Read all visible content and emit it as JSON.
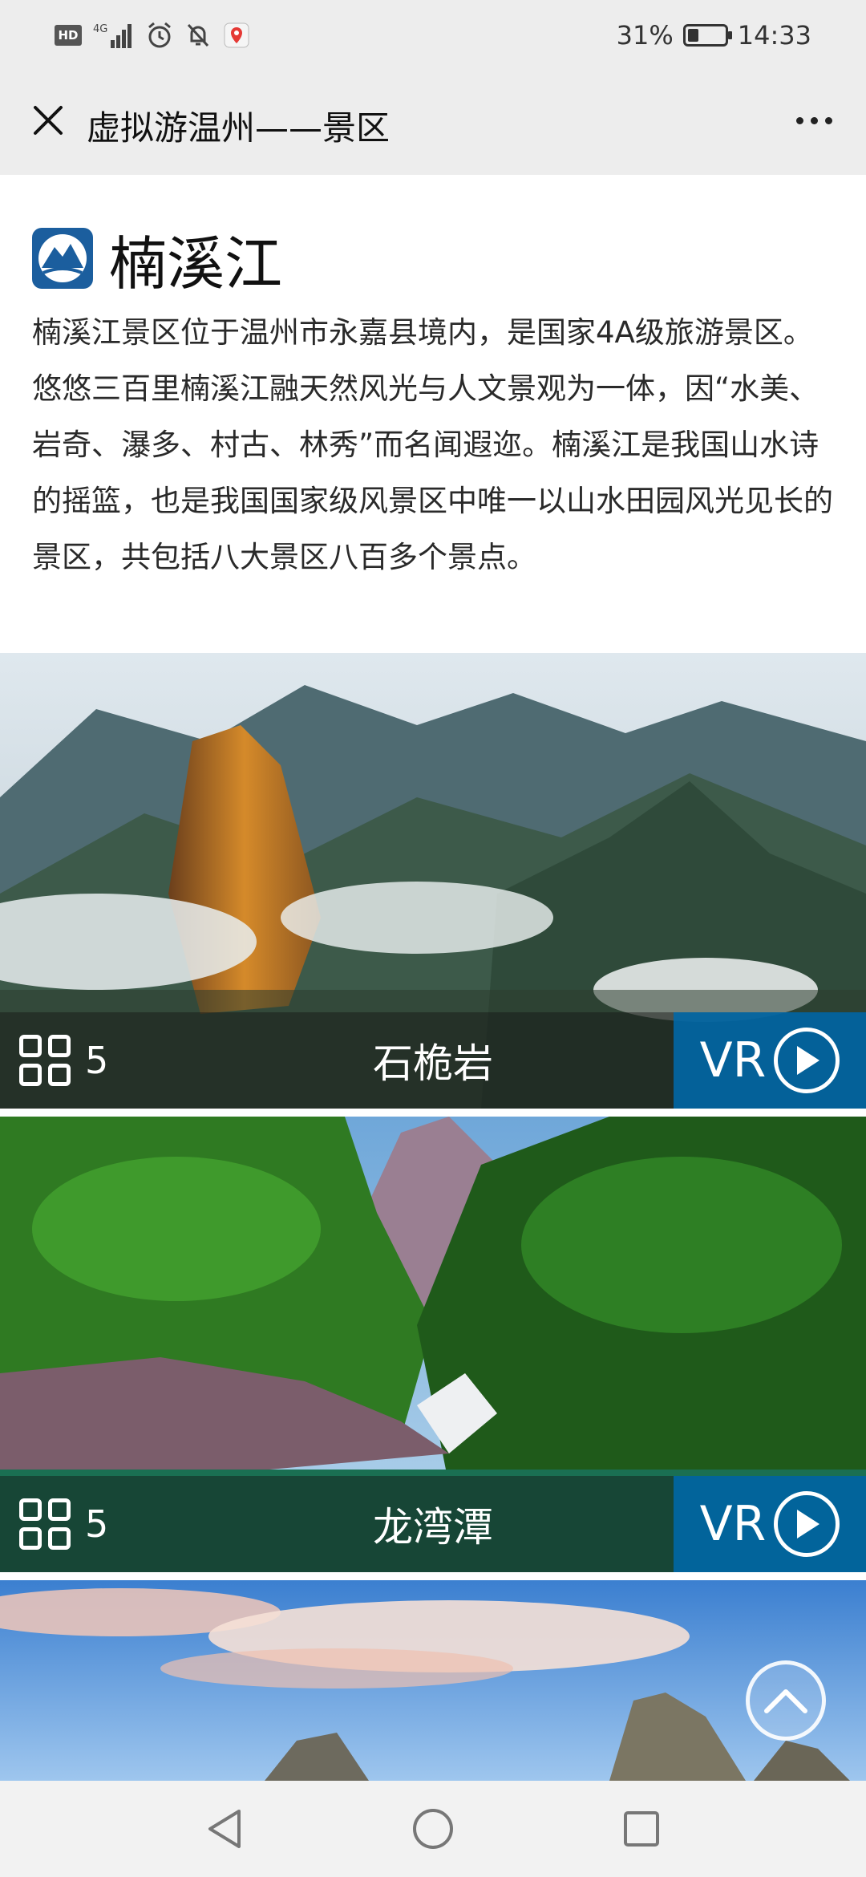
{
  "status_bar": {
    "hd_label": "HD",
    "network_label": "4G",
    "battery_percent": "31%",
    "battery_level": 0.31,
    "time": "14:33"
  },
  "nav": {
    "title": "虚拟游温州——景区"
  },
  "section": {
    "title": "楠溪江",
    "description": "楠溪江景区位于温州市永嘉县境内，是国家4A级旅游景区。悠悠三百里楠溪江融天然风光与人文景观为一体，因“水美、岩奇、瀑多、村古、林秀”而名闻遐迩。楠溪江是我国山水诗的摇篮，也是我国国家级风景区中唯一以山水田园风光见长的景区，共包括八大景区八百多个景点。"
  },
  "cards": [
    {
      "name": "石桅岩",
      "count": "5",
      "vr_label": "VR"
    },
    {
      "name": "龙湾潭",
      "count": "5",
      "vr_label": "VR"
    }
  ],
  "icons": {
    "close": "close-icon",
    "more": "more-icon",
    "grid": "grid-icon",
    "play": "play-icon",
    "back_to_top": "chevron-up-icon",
    "back": "back-triangle-icon",
    "home": "home-circle-icon",
    "recents": "recents-square-icon"
  },
  "colors": {
    "nav_bg": "#ededed",
    "vr_blue": "#0069aa"
  }
}
